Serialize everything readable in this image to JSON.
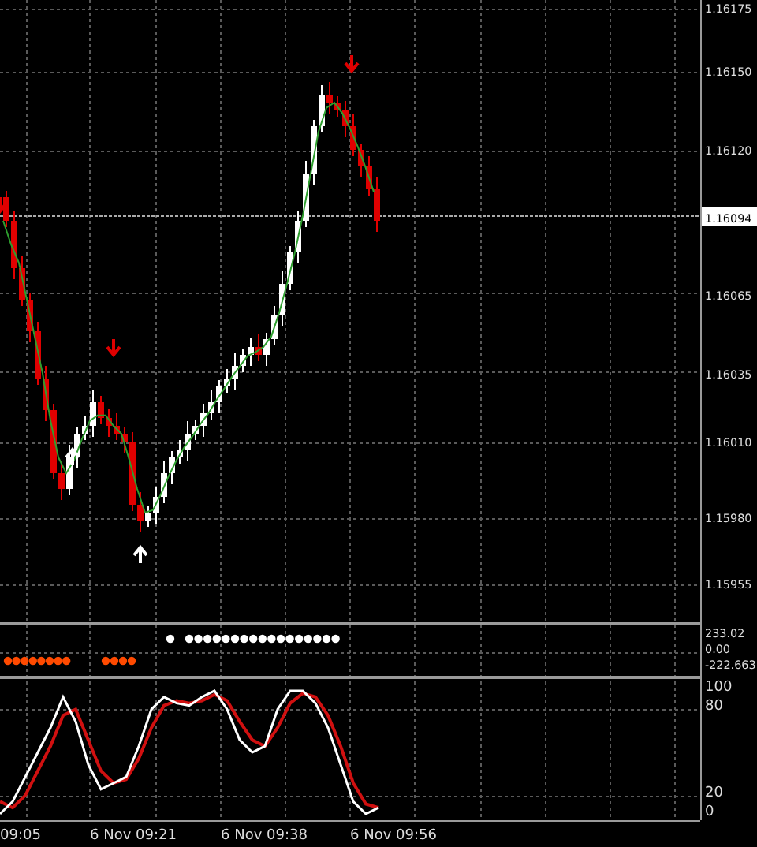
{
  "price_axis": [
    {
      "label": "1.16175",
      "kind": "tick"
    },
    {
      "label": "1.16150",
      "kind": "tick"
    },
    {
      "label": "1.16120",
      "kind": "tick"
    },
    {
      "label": "1.16094",
      "kind": "current"
    },
    {
      "label": "1.16065",
      "kind": "tick"
    },
    {
      "label": "1.16035",
      "kind": "tick"
    },
    {
      "label": "1.16010",
      "kind": "tick"
    },
    {
      "label": "1.15980",
      "kind": "tick"
    },
    {
      "label": "1.15955",
      "kind": "tick"
    }
  ],
  "indicator_axis": [
    "233.02",
    "0.00",
    "-222.663"
  ],
  "oscillator_axis": [
    "100",
    "80",
    "20",
    "0"
  ],
  "time_axis": [
    "09:05",
    "6 Nov 09:21",
    "6 Nov 09:38",
    "6 Nov 09:56"
  ]
}
